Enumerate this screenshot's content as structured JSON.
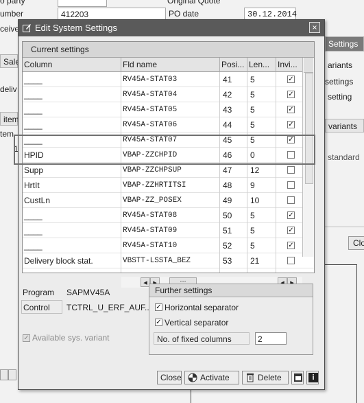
{
  "background": {
    "top_cut_labels": [
      "o party",
      "Original Quote"
    ],
    "number_label": "umber",
    "number_value": "412203",
    "po_date_label": "PO date",
    "po_date_value": "30.12.2014",
    "receive_label": "ceive",
    "sales_tab": "Sales",
    "deliv_label": "deliv",
    "item_label": "item",
    "item_label2": "tem",
    "row_num": "1",
    "settings_tab": "Settings",
    "variants_label": "ariants",
    "settings_label": "settings",
    "setting_label": "setting",
    "variants_label2": "variants",
    "standard_label": "standard",
    "close_cut": "Clos"
  },
  "dialog": {
    "title": "Edit System Settings",
    "close_glyph": "×",
    "grid_title": "Current settings",
    "columns": [
      "Column",
      "Fld name",
      "Posi...",
      "Len...",
      "Invi..."
    ],
    "rows": [
      {
        "column": "____",
        "fld": "RV45A-STAT03",
        "pos": "41",
        "len": "5",
        "invisible": true
      },
      {
        "column": "____",
        "fld": "RV45A-STAT04",
        "pos": "42",
        "len": "5",
        "invisible": true
      },
      {
        "column": "____",
        "fld": "RV45A-STAT05",
        "pos": "43",
        "len": "5",
        "invisible": true
      },
      {
        "column": "____",
        "fld": "RV45A-STAT06",
        "pos": "44",
        "len": "5",
        "invisible": true
      },
      {
        "column": "____",
        "fld": "RV45A-STAT07",
        "pos": "45",
        "len": "5",
        "invisible": true
      },
      {
        "column": "HPID",
        "fld": "VBAP-ZZCHPID",
        "pos": "46",
        "len": "0",
        "invisible": false
      },
      {
        "column": "Supp",
        "fld": "VBAP-ZZCHPSUP",
        "pos": "47",
        "len": "12",
        "invisible": false
      },
      {
        "column": "HrtIt",
        "fld": "VBAP-ZZHRTITSI",
        "pos": "48",
        "len": "9",
        "invisible": false
      },
      {
        "column": "CustLn",
        "fld": "VBAP-ZZ_POSEX",
        "pos": "49",
        "len": "10",
        "invisible": false
      },
      {
        "column": "____",
        "fld": "RV45A-STAT08",
        "pos": "50",
        "len": "5",
        "invisible": true
      },
      {
        "column": "____",
        "fld": "RV45A-STAT09",
        "pos": "51",
        "len": "5",
        "invisible": true
      },
      {
        "column": "____",
        "fld": "RV45A-STAT10",
        "pos": "52",
        "len": "5",
        "invisible": true
      },
      {
        "column": "Delivery block stat.",
        "fld": "VBSTT-LSSTA_BEZ",
        "pos": "53",
        "len": "21",
        "invisible": false
      }
    ],
    "program_label": "Program",
    "program_value": "SAPMV45A",
    "control_label": "Control",
    "control_value": "TCTRL_U_ERF_AUF...",
    "available_variant_label": "Available sys. variant",
    "further_settings_title": "Further settings",
    "horizontal_separator_label": "Horizontal separator",
    "horizontal_separator_checked": true,
    "vertical_separator_label": "Vertical separator",
    "vertical_separator_checked": true,
    "fixed_columns_label": "No. of fixed columns",
    "fixed_columns_value": "2",
    "buttons": {
      "close": "Close",
      "activate": "Activate",
      "delete": "Delete"
    }
  }
}
